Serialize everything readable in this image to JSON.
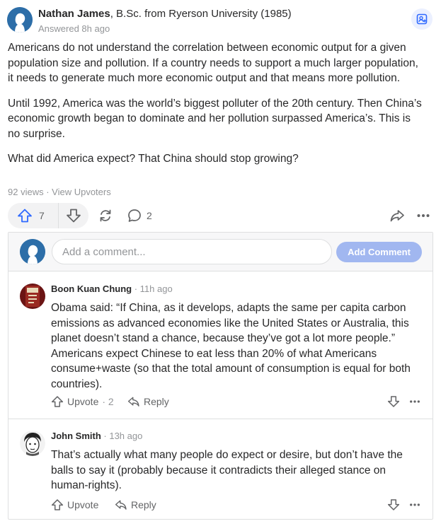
{
  "answer": {
    "author_name": "Nathan James",
    "author_credential": ", B.Sc. from Ryerson University (1985)",
    "answered_time": "Answered 8h ago",
    "paragraphs": [
      "Americans do not understand the correlation between economic output for a given population size and pollution. If a country needs to support a much larger population, it needs to generate much more economic output and that means more pollution.",
      "Until 1992, America was the world’s biggest polluter of the 20th century. Then China’s economic growth began to dominate and her pollution surpassed America’s. This is no surprise.",
      "What did America expect? That China should stop growing?"
    ],
    "views": "92 views",
    "separator": " · ",
    "view_upvoters": "View Upvoters",
    "upvote_count": "7",
    "comment_count": "2"
  },
  "add_comment": {
    "placeholder": "Add a comment...",
    "button_label": "Add Comment"
  },
  "comments": [
    {
      "author": "Boon Kuan Chung",
      "time": " · 11h ago",
      "text": "Obama said: “If China, as it develops, adapts the same per capita carbon emissions as advanced economies like the United States or Australia, this planet doesn’t stand a chance, because they’ve got a lot more people.” Americans expect Chinese to eat less than 20% of what Americans consume+waste (so that the total amount of consumption is equal for both countries).",
      "upvote_label": "Upvote",
      "upvote_count": " · 2",
      "reply_label": "Reply"
    },
    {
      "author": "John Smith",
      "time": " · 13h ago",
      "text": "That’s actually what many people do expect or desire, but don’t have the balls to say it (probably because it contradicts their alleged stance on human-rights).",
      "upvote_label": "Upvote",
      "upvote_count": "",
      "reply_label": "Reply"
    }
  ],
  "colors": {
    "accent_blue": "#2e69ff",
    "avatar_blue": "#2d6ea8",
    "add_comment_button": "#a1b7f0",
    "muted_text": "#939598"
  },
  "icons": [
    "profile-silhouette-icon",
    "add-to-space-icon",
    "upvote-arrow-icon",
    "downvote-arrow-icon",
    "reshare-icon",
    "comment-bubble-icon",
    "share-forward-icon",
    "more-dots-icon",
    "reply-icon"
  ]
}
